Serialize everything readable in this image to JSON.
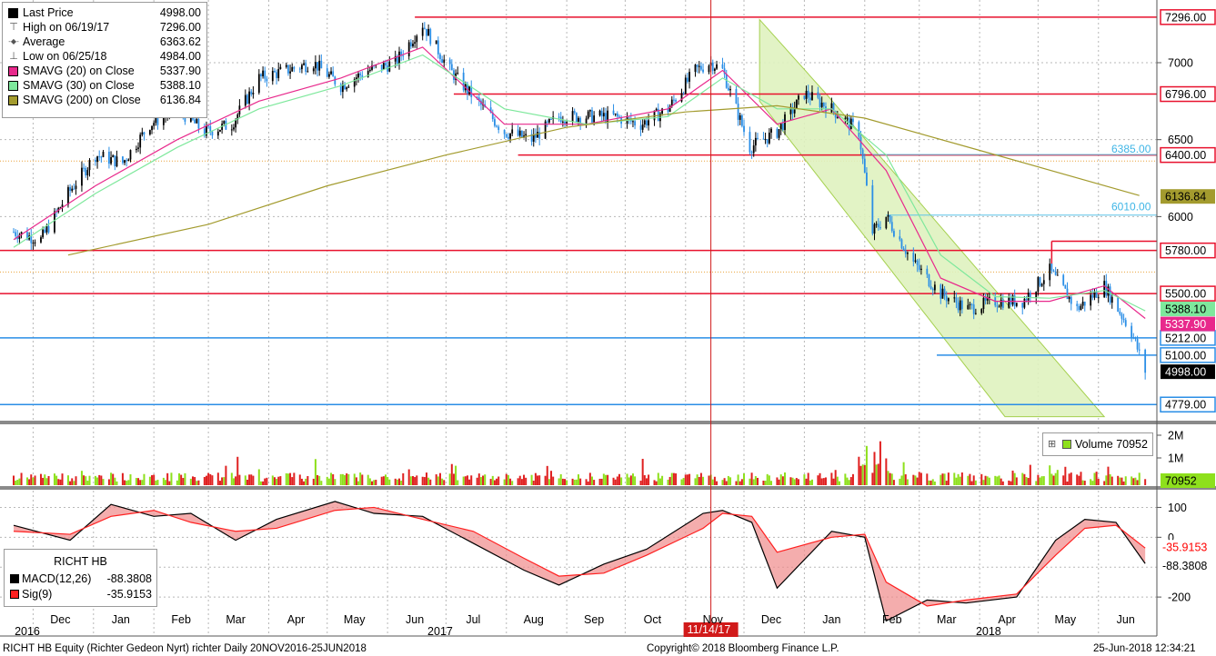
{
  "legend": {
    "items": [
      {
        "label": "Last Price",
        "value": "4998.00",
        "color": "#000000",
        "glyph": ""
      },
      {
        "label": "High on 06/19/17",
        "value": "7296.00",
        "color": "",
        "glyph": "⊤"
      },
      {
        "label": "Average",
        "value": "6363.62",
        "color": "",
        "glyph": "-◆-"
      },
      {
        "label": "Low on 06/25/18",
        "value": "4984.00",
        "color": "",
        "glyph": "⊥"
      },
      {
        "label": "SMAVG (20) on Close",
        "value": "5337.90",
        "color": "#e8298c",
        "glyph": ""
      },
      {
        "label": "SMAVG (30) on Close",
        "value": "5388.10",
        "color": "#7ee89c",
        "glyph": ""
      },
      {
        "label": "SMAVG (200) on Close",
        "value": "6136.84",
        "color": "#a39b2e",
        "glyph": ""
      }
    ]
  },
  "volume_legend": {
    "glyph": "⊞",
    "label": "Volume",
    "value": "70952"
  },
  "macd_legend": {
    "title": "RICHT HB",
    "items": [
      {
        "label": "MACD(12,26)",
        "value": "-88.3808",
        "color": "#000000"
      },
      {
        "label": "Sig(9)",
        "value": "-35.9153",
        "color": "#ff2020"
      }
    ]
  },
  "footer": {
    "left": "RICHT HB Equity (Richter Gedeon Nyrt) richter  Daily 20NOV2016-25JUN2018",
    "center": "Copyright© 2018 Bloomberg Finance L.P.",
    "right": "25-Jun-2018 12:34:21"
  },
  "cursor_date": "11/14/17",
  "colors": {
    "red_line": "#e8112d",
    "blue_line": "#2a8ee6",
    "channel": "#dff2bf",
    "channel_edge": "#9ccc3c",
    "volume": "#8ee01c",
    "volume_down": "#e02020"
  },
  "chart_data": [
    {
      "type": "line",
      "title": "RICHT HB Equity (Richter Gedeon Nyrt)",
      "y_ticks": [
        6000,
        6500,
        7000
      ],
      "ylim": [
        4680,
        7360
      ],
      "x_labels": [
        "Dec",
        "Jan",
        "Feb",
        "Mar",
        "Apr",
        "May",
        "Jun",
        "Jul",
        "Aug",
        "Sep",
        "Oct",
        "Nov",
        "Dec",
        "Jan",
        "Feb",
        "Mar",
        "Apr",
        "May",
        "Jun"
      ],
      "year_labels": [
        "2016",
        "2017",
        "2018"
      ],
      "series": [
        {
          "name": "Last Price",
          "x": [
            "2016-11-21",
            "2016-12-05",
            "2016-12-19",
            "2017-01-02",
            "2017-01-16",
            "2017-01-30",
            "2017-02-13",
            "2017-02-27",
            "2017-03-13",
            "2017-03-27",
            "2017-04-10",
            "2017-04-24",
            "2017-05-08",
            "2017-05-22",
            "2017-06-05",
            "2017-06-19",
            "2017-07-03",
            "2017-07-17",
            "2017-07-31",
            "2017-08-14",
            "2017-08-28",
            "2017-09-11",
            "2017-09-25",
            "2017-10-09",
            "2017-10-23",
            "2017-11-06",
            "2017-11-14",
            "2017-11-20",
            "2017-12-04",
            "2017-12-18",
            "2018-01-01",
            "2018-01-15",
            "2018-01-29",
            "2018-02-05",
            "2018-02-12",
            "2018-02-26",
            "2018-03-12",
            "2018-03-26",
            "2018-04-09",
            "2018-04-23",
            "2018-05-07",
            "2018-05-21",
            "2018-06-04",
            "2018-06-18",
            "2018-06-25"
          ],
          "values": [
            5900,
            5850,
            6150,
            6400,
            6350,
            6600,
            6700,
            6550,
            6600,
            6900,
            6950,
            7000,
            6850,
            6950,
            7000,
            7250,
            6950,
            6750,
            6550,
            6500,
            6650,
            6650,
            6650,
            6600,
            6700,
            6950,
            7000,
            6950,
            6450,
            6550,
            6800,
            6700,
            6550,
            5900,
            6000,
            5700,
            5500,
            5400,
            5450,
            5450,
            5650,
            5400,
            5550,
            5250,
            4998
          ]
        },
        {
          "name": "SMAVG (20) on Close",
          "x": [
            "2016-11-21",
            "2017-01-02",
            "2017-02-13",
            "2017-03-27",
            "2017-05-08",
            "2017-06-19",
            "2017-07-31",
            "2017-09-11",
            "2017-10-23",
            "2017-11-20",
            "2017-12-18",
            "2018-01-15",
            "2018-02-12",
            "2018-03-12",
            "2018-04-09",
            "2018-05-07",
            "2018-06-04",
            "2018-06-25"
          ],
          "values": [
            5850,
            6200,
            6500,
            6750,
            6900,
            7100,
            6600,
            6600,
            6700,
            6950,
            6600,
            6700,
            6300,
            5600,
            5450,
            5450,
            5550,
            5338
          ]
        },
        {
          "name": "SMAVG (30) on Close",
          "x": [
            "2016-11-21",
            "2017-01-02",
            "2017-02-13",
            "2017-03-27",
            "2017-05-08",
            "2017-06-19",
            "2017-07-31",
            "2017-09-11",
            "2017-10-23",
            "2017-11-20",
            "2017-12-18",
            "2018-01-15",
            "2018-02-12",
            "2018-03-12",
            "2018-04-09",
            "2018-05-07",
            "2018-06-04",
            "2018-06-25"
          ],
          "values": [
            5800,
            6150,
            6450,
            6700,
            6850,
            7050,
            6700,
            6600,
            6650,
            6900,
            6700,
            6700,
            6400,
            5750,
            5480,
            5470,
            5520,
            5388
          ]
        },
        {
          "name": "SMAVG (200) on Close",
          "x": [
            "2016-12-19",
            "2017-03-01",
            "2017-05-01",
            "2017-07-01",
            "2017-09-01",
            "2017-11-01",
            "2017-12-18",
            "2018-02-01",
            "2018-04-01",
            "2018-06-22"
          ],
          "values": [
            5750,
            5950,
            6200,
            6400,
            6580,
            6680,
            6720,
            6640,
            6430,
            6137
          ]
        }
      ],
      "horizontal_levels": [
        {
          "value": 7296.0,
          "color": "red",
          "label": "7296.00"
        },
        {
          "value": 6796.0,
          "color": "red",
          "label": "6796.00"
        },
        {
          "value": 6400.0,
          "color": "red",
          "label": "6400.00"
        },
        {
          "value": 5780.0,
          "color": "red",
          "label": "5780.00"
        },
        {
          "value": 5500.0,
          "color": "red",
          "label": "5500.00"
        },
        {
          "value": 5212.0,
          "color": "blue",
          "label": "5212.00"
        },
        {
          "value": 5100.0,
          "color": "blue",
          "label": "5100.00"
        },
        {
          "value": 4779.0,
          "color": "blue",
          "label": "4779.00"
        }
      ],
      "annotations": [
        {
          "text": "6385.00",
          "value": 6385.0
        },
        {
          "text": "6010.00",
          "value": 6010.0
        }
      ],
      "axis_tags": [
        {
          "text": "6136.84",
          "bg": "#a39b2e",
          "fg": "#000000"
        },
        {
          "text": "5388.10",
          "bg": "#7ee89c",
          "fg": "#000000"
        },
        {
          "text": "5337.90",
          "bg": "#e8298c",
          "fg": "#ffffff"
        },
        {
          "text": "4998.00",
          "bg": "#000000",
          "fg": "#ffffff"
        }
      ]
    },
    {
      "type": "bar",
      "title": "Volume",
      "y_ticks": [
        "1M",
        "2M"
      ],
      "last_value": 70952
    },
    {
      "type": "line",
      "title": "MACD",
      "y_ticks": [
        100,
        0,
        -200
      ],
      "ylim": [
        -300,
        150
      ],
      "series": [
        {
          "name": "MACD(12,26)",
          "x": [
            "2016-11-21",
            "2016-12-20",
            "2017-01-10",
            "2017-02-01",
            "2017-02-20",
            "2017-03-15",
            "2017-04-05",
            "2017-05-05",
            "2017-05-25",
            "2017-06-19",
            "2017-07-15",
            "2017-08-10",
            "2017-08-28",
            "2017-09-20",
            "2017-10-12",
            "2017-11-10",
            "2017-11-20",
            "2017-12-05",
            "2017-12-18",
            "2018-01-15",
            "2018-02-01",
            "2018-02-12",
            "2018-03-05",
            "2018-03-25",
            "2018-04-20",
            "2018-05-10",
            "2018-05-25",
            "2018-06-10",
            "2018-06-25"
          ],
          "values": [
            40,
            -10,
            110,
            70,
            80,
            -10,
            60,
            120,
            80,
            70,
            -20,
            -110,
            -160,
            -90,
            -40,
            80,
            90,
            50,
            -170,
            20,
            0,
            -280,
            -210,
            -220,
            -200,
            -10,
            60,
            50,
            -88
          ]
        },
        {
          "name": "Sig(9)",
          "x": [
            "2016-11-21",
            "2016-12-20",
            "2017-01-10",
            "2017-02-01",
            "2017-02-20",
            "2017-03-15",
            "2017-04-05",
            "2017-05-05",
            "2017-05-25",
            "2017-06-19",
            "2017-07-15",
            "2017-08-10",
            "2017-08-28",
            "2017-09-20",
            "2017-10-12",
            "2017-11-10",
            "2017-11-20",
            "2017-12-05",
            "2017-12-18",
            "2018-01-15",
            "2018-02-01",
            "2018-02-12",
            "2018-03-05",
            "2018-03-25",
            "2018-04-20",
            "2018-05-10",
            "2018-05-25",
            "2018-06-10",
            "2018-06-25"
          ],
          "values": [
            20,
            10,
            70,
            90,
            50,
            20,
            30,
            90,
            100,
            60,
            20,
            -70,
            -130,
            -120,
            -60,
            30,
            80,
            70,
            -50,
            0,
            10,
            -150,
            -230,
            -210,
            -190,
            -60,
            30,
            40,
            -36
          ]
        }
      ]
    }
  ]
}
